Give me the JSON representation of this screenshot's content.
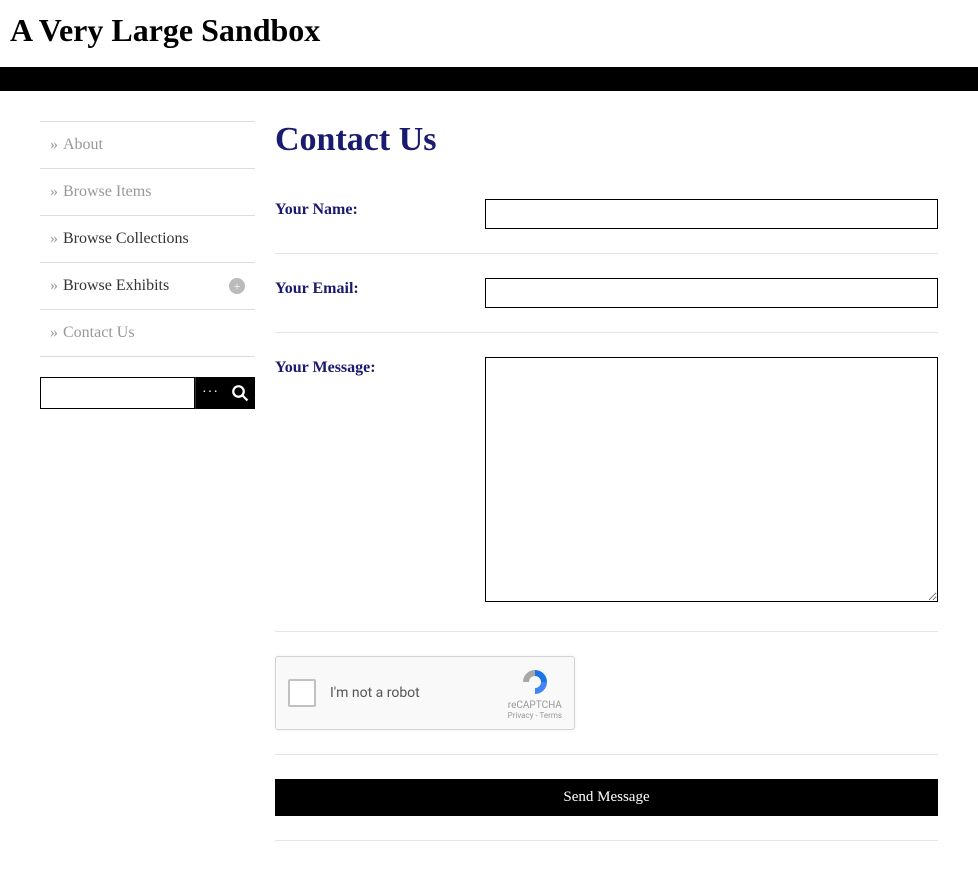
{
  "header": {
    "site_title": "A Very Large Sandbox"
  },
  "sidebar": {
    "items": [
      {
        "label": "About",
        "active": false,
        "dark": false,
        "expandable": false
      },
      {
        "label": "Browse Items",
        "active": false,
        "dark": false,
        "expandable": false
      },
      {
        "label": "Browse Collections",
        "active": false,
        "dark": true,
        "expandable": false
      },
      {
        "label": "Browse Exhibits",
        "active": false,
        "dark": true,
        "expandable": true
      },
      {
        "label": "Contact Us",
        "active": false,
        "dark": false,
        "expandable": false
      }
    ],
    "search": {
      "value": "",
      "options_label": "···"
    }
  },
  "main": {
    "page_title": "Contact Us",
    "form": {
      "name": {
        "label": "Your Name:",
        "value": ""
      },
      "email": {
        "label": "Your Email:",
        "value": ""
      },
      "message": {
        "label": "Your Message:",
        "value": ""
      }
    },
    "recaptcha": {
      "label": "I'm not a robot",
      "brand": "reCAPTCHA",
      "links": "Privacy - Terms"
    },
    "submit_label": "Send Message"
  }
}
